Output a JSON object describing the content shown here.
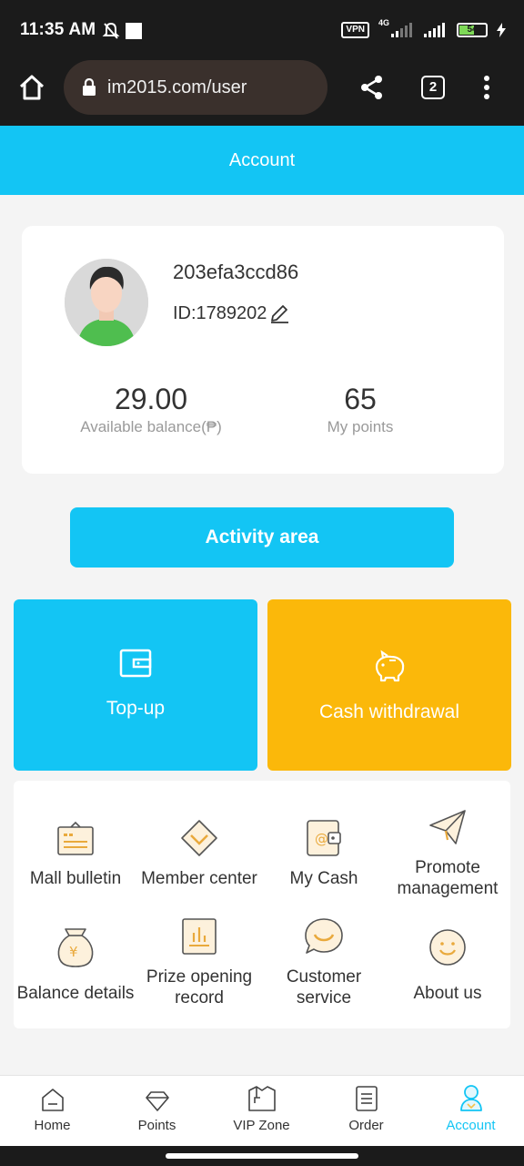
{
  "status_bar": {
    "time": "11:35 AM",
    "vpn": "VPN",
    "network": "4G",
    "battery": "54"
  },
  "browser": {
    "url": "im2015.com/user",
    "tab_count": "2"
  },
  "header": {
    "title": "Account"
  },
  "profile": {
    "username": "203efa3ccd86",
    "user_id": "ID:1789202",
    "balance_value": "29.00",
    "balance_label": "Available balance(₱)",
    "points_value": "65",
    "points_label": "My points"
  },
  "activity_button": "Activity area",
  "tiles": {
    "topup": "Top-up",
    "withdraw": "Cash withdrawal"
  },
  "menu": [
    {
      "label": "Mall bulletin",
      "icon": "bulletin-icon"
    },
    {
      "label": "Member center",
      "icon": "diamond-icon"
    },
    {
      "label": "My Cash",
      "icon": "wallet-icon"
    },
    {
      "label": "Promote management",
      "icon": "paper-plane-icon"
    },
    {
      "label": "Balance details",
      "icon": "money-bag-icon"
    },
    {
      "label": "Prize opening record",
      "icon": "bar-chart-icon"
    },
    {
      "label": "Customer service",
      "icon": "chat-smile-icon"
    },
    {
      "label": "About us",
      "icon": "smile-icon"
    }
  ],
  "bottom_nav": [
    {
      "label": "Home",
      "active": false
    },
    {
      "label": "Points",
      "active": false
    },
    {
      "label": "VIP Zone",
      "active": false
    },
    {
      "label": "Order",
      "active": false
    },
    {
      "label": "Account",
      "active": true
    }
  ],
  "colors": {
    "primary": "#13c5f4",
    "accent_orange": "#fbb80a",
    "menu_icon": "#e9a93c"
  }
}
